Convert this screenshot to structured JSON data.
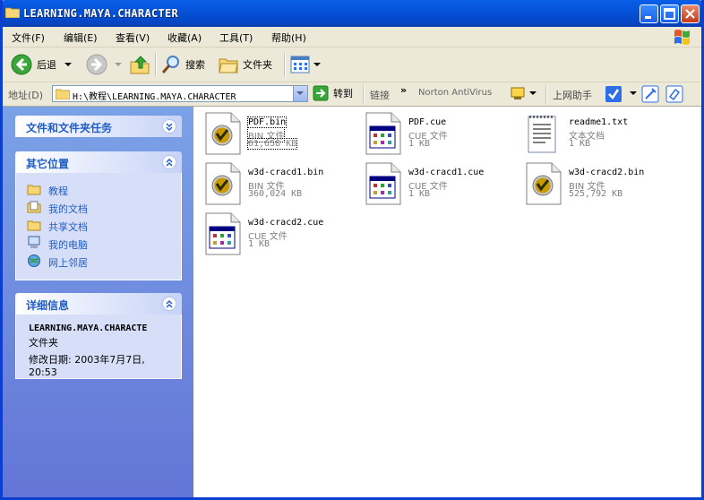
{
  "window": {
    "title": "LEARNING.MAYA.CHARACTER"
  },
  "menu": [
    {
      "label": "文件(F)"
    },
    {
      "label": "编辑(E)"
    },
    {
      "label": "查看(V)"
    },
    {
      "label": "收藏(A)"
    },
    {
      "label": "工具(T)"
    },
    {
      "label": "帮助(H)"
    }
  ],
  "toolbar": {
    "back_label": "后退",
    "search_label": "搜索",
    "folders_label": "文件夹"
  },
  "address": {
    "label": "地址(D)",
    "value": "H:\\教程\\LEARNING.MAYA.CHARACTER",
    "go_label": "转到",
    "links_label": "链接",
    "norton_label": "Norton AntiVirus",
    "online_label": "上网助手"
  },
  "tasks_panel": {
    "title": "文件和文件夹任务"
  },
  "places_panel": {
    "title": "其它位置",
    "items": [
      {
        "label": "教程",
        "icon": "folder-icon"
      },
      {
        "label": "我的文档",
        "icon": "documents-icon"
      },
      {
        "label": "共享文档",
        "icon": "folder-icon"
      },
      {
        "label": "我的电脑",
        "icon": "computer-icon"
      },
      {
        "label": "网上邻居",
        "icon": "network-icon"
      }
    ]
  },
  "details_panel": {
    "title": "详细信息",
    "name": "LEARNING.MAYA.CHARACTE",
    "type": "文件夹",
    "modified_line1": "修改日期: 2003年7月7日,",
    "modified_line2": "20:53"
  },
  "files": [
    {
      "name": "PDF.bin",
      "type": "BIN 文件",
      "size": "61,658 KB",
      "icon": "bin-icon"
    },
    {
      "name": "PDF.cue",
      "type": "CUE 文件",
      "size": "1 KB",
      "icon": "cue-icon"
    },
    {
      "name": "readme1.txt",
      "type": "文本文档",
      "size": "1 KB",
      "icon": "text-icon"
    },
    {
      "name": "w3d-cracd1.bin",
      "type": "BIN 文件",
      "size": "360,024 KB",
      "icon": "bin-icon"
    },
    {
      "name": "w3d-cracd1.cue",
      "type": "CUE 文件",
      "size": "1 KB",
      "icon": "cue-icon"
    },
    {
      "name": "w3d-cracd2.bin",
      "type": "BIN 文件",
      "size": "525,792 KB",
      "icon": "bin-icon"
    },
    {
      "name": "w3d-cracd2.cue",
      "type": "CUE 文件",
      "size": "1 KB",
      "icon": "cue-icon"
    }
  ],
  "colors": {
    "titlebar": "#0553d8",
    "link_blue": "#215dc6",
    "pane_top": "#7ba2e7",
    "pane_bottom": "#6375d6"
  }
}
